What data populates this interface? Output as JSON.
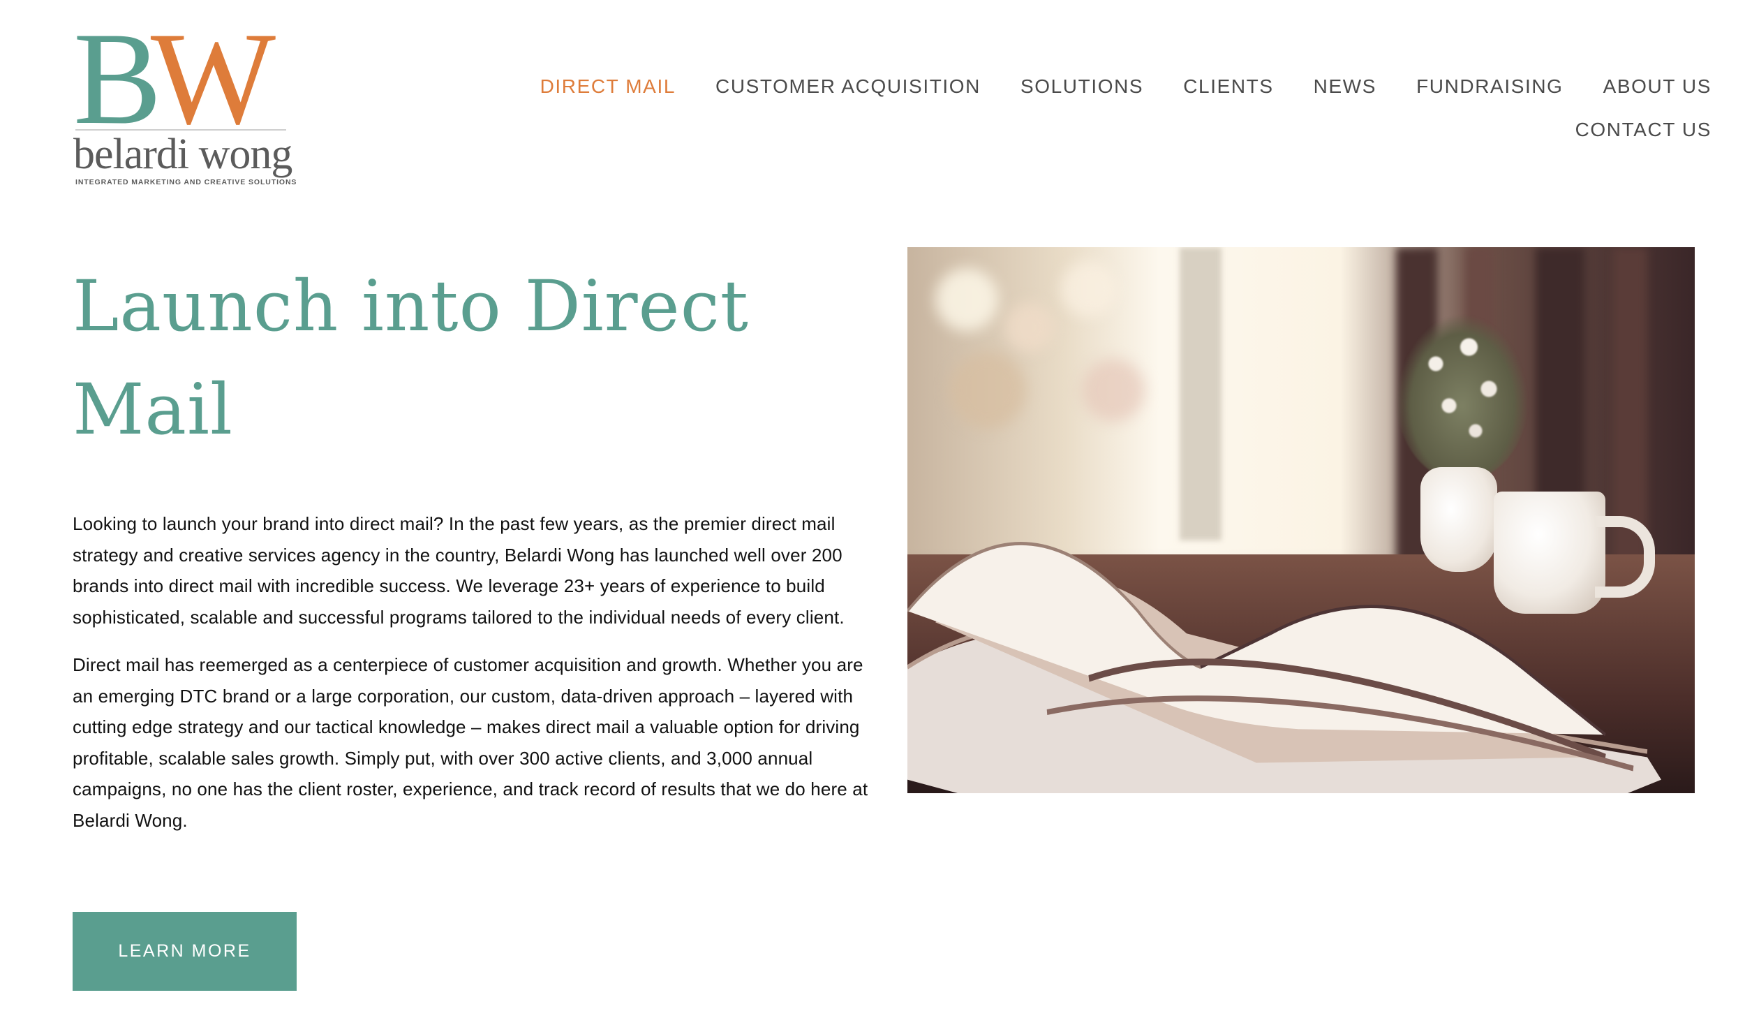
{
  "brand": {
    "logo_mark_b": "B",
    "logo_mark_w": "W",
    "logo_wordmark": "belardi wong",
    "logo_tagline": "INTEGRATED MARKETING AND CREATIVE SOLUTIONS",
    "colors": {
      "teal": "#5a9e8f",
      "orange": "#de7c3a",
      "nav_text": "#4a4a4a",
      "body_text": "#111111"
    }
  },
  "nav": {
    "items": [
      {
        "label": "DIRECT MAIL",
        "active": true
      },
      {
        "label": "CUSTOMER ACQUISITION",
        "active": false
      },
      {
        "label": "SOLUTIONS",
        "active": false
      },
      {
        "label": "CLIENTS",
        "active": false
      },
      {
        "label": "NEWS",
        "active": false
      },
      {
        "label": "FUNDRAISING",
        "active": false
      },
      {
        "label": "ABOUT US",
        "active": false
      },
      {
        "label": "CONTACT US",
        "active": false
      }
    ]
  },
  "main": {
    "headline": "Launch into Direct Mail",
    "paragraphs": [
      "Looking to launch your brand into direct mail? In the past few years, as the premier direct mail strategy and creative services agency in the country, Belardi Wong has launched well over 200 brands into direct mail with incredible success. We leverage 23+ years of experience to build sophisticated, scalable and successful programs tailored to the individual needs of every client.",
      "Direct mail has reemerged as a centerpiece of customer acquisition and growth. Whether you are an emerging DTC brand or a large corporation, our custom, data-driven approach –  layered with cutting edge strategy and our tactical knowledge – makes direct mail a valuable option for driving profitable, scalable sales growth. Simply put, with over 300 active clients, and 3,000 annual campaigns, no one has the client roster, experience, and track record of results that we do here at Belardi Wong."
    ],
    "cta_label": "LEARN MORE"
  },
  "hero_image": {
    "icon": "magazines-photo"
  }
}
